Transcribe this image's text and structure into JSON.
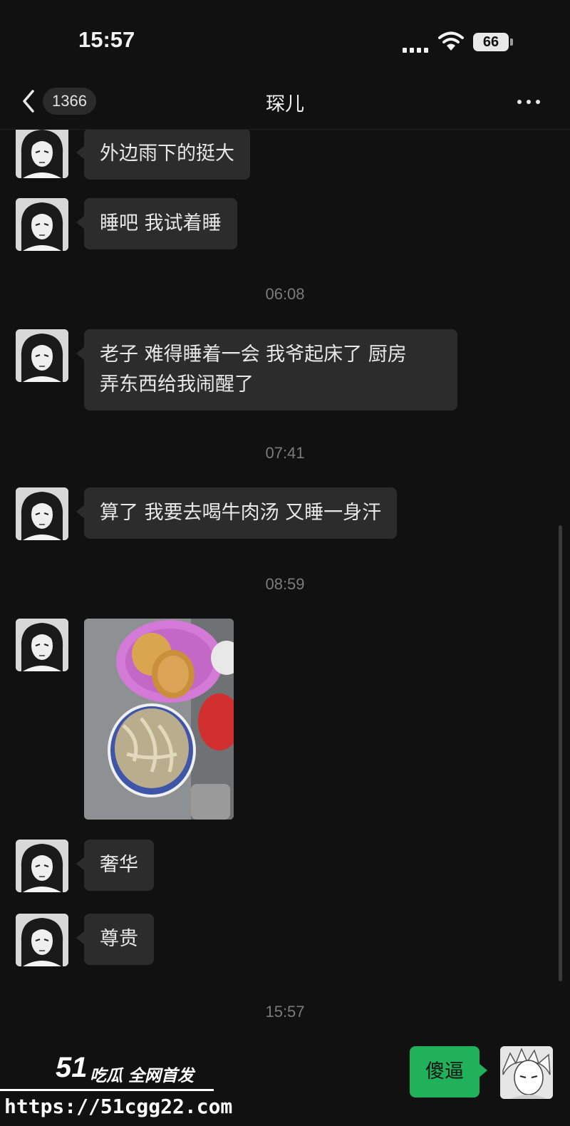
{
  "status_bar": {
    "time": "15:57",
    "battery": "66"
  },
  "nav": {
    "unread_count": "1366",
    "title": "琛儿"
  },
  "messages": {
    "m1": "外边雨下的挺大",
    "m2": "睡吧 我试着睡",
    "t1": "06:08",
    "m3_line1": "老子 难得睡着一会 我爷起床了 厨房",
    "m3_line2": "弄东西给我闹醒了",
    "t2": "07:41",
    "m4": "算了 我要去喝牛肉汤 又睡一身汗",
    "t3": "08:59",
    "m6": "奢华",
    "m7": "尊贵",
    "t4": "15:57",
    "self1": "傻逼"
  },
  "watermark": {
    "logo_number": "51",
    "tagline": "吃瓜 全网首发",
    "url": "https://51cgg22.com"
  },
  "colors": {
    "background": "#111111",
    "bubble": "#2c2c2c",
    "self_bubble": "#20b15a"
  }
}
